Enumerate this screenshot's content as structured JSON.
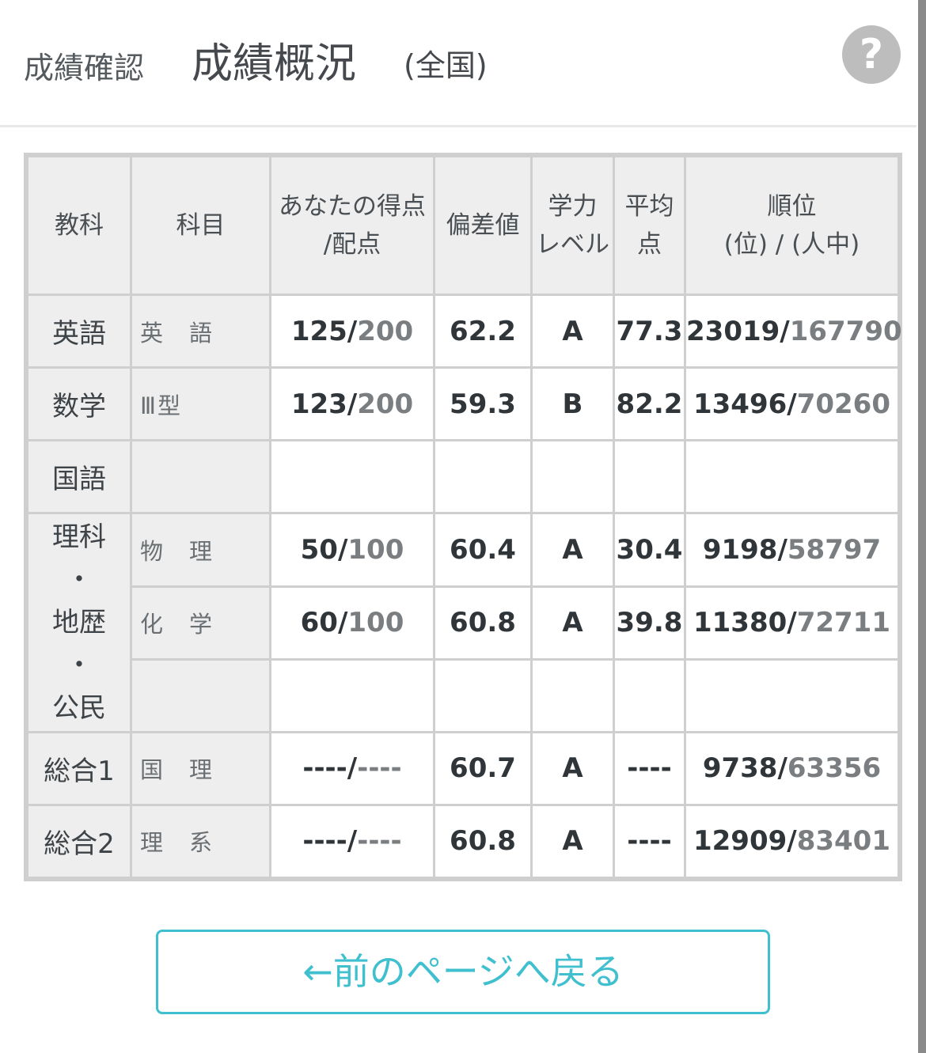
{
  "header": {
    "breadcrumb": "成績確認",
    "title": "成績概況",
    "title_sub": "(全国)",
    "help_label": "?"
  },
  "table": {
    "headers": {
      "subject": "教科",
      "course": "科目",
      "score_line1": "あなたの得点",
      "score_line2": "/配点",
      "deviation": "偏差値",
      "level_line1": "学力",
      "level_line2": "レベル",
      "avg_line1": "平均",
      "avg_line2": "点",
      "rank_line1": "順位",
      "rank_line2": "(位) / (人中)"
    },
    "rows": [
      {
        "subject": "英語",
        "course": "英　語",
        "score": "125/",
        "max": "200",
        "deviation": "62.2",
        "level": "A",
        "avg": "77.3",
        "rank": "23019/",
        "total": "167790"
      },
      {
        "subject": "数学",
        "course": "Ⅲ型",
        "score": "123/",
        "max": "200",
        "deviation": "59.3",
        "level": "B",
        "avg": "82.2",
        "rank": "13496/",
        "total": "70260"
      },
      {
        "subject": "国語",
        "course": "",
        "score": "",
        "max": "",
        "deviation": "",
        "level": "",
        "avg": "",
        "rank": "",
        "total": ""
      },
      {
        "subject": "",
        "course": "物　理",
        "score": "50/",
        "max": "100",
        "deviation": "60.4",
        "level": "A",
        "avg": "30.4",
        "rank": "9198/",
        "total": "58797"
      },
      {
        "subject": "",
        "course": "化　学",
        "score": "60/",
        "max": "100",
        "deviation": "60.8",
        "level": "A",
        "avg": "39.8",
        "rank": "11380/",
        "total": "72711"
      },
      {
        "subject": "",
        "course": "",
        "score": "",
        "max": "",
        "deviation": "",
        "level": "",
        "avg": "",
        "rank": "",
        "total": ""
      },
      {
        "subject": "総合1",
        "course": "国　理",
        "score": "----/",
        "max": "----",
        "deviation": "60.7",
        "level": "A",
        "avg": "----",
        "rank": "9738/",
        "total": "63356"
      },
      {
        "subject": "総合2",
        "course": "理　系",
        "score": "----/",
        "max": "----",
        "deviation": "60.8",
        "level": "A",
        "avg": "----",
        "rank": "12909/",
        "total": "83401"
      }
    ],
    "science_group": {
      "line1": "理科",
      "dot1": "・",
      "line2": "地歴",
      "dot2": "・",
      "line3": "公民"
    }
  },
  "back_button": "←前のページへ戻る"
}
